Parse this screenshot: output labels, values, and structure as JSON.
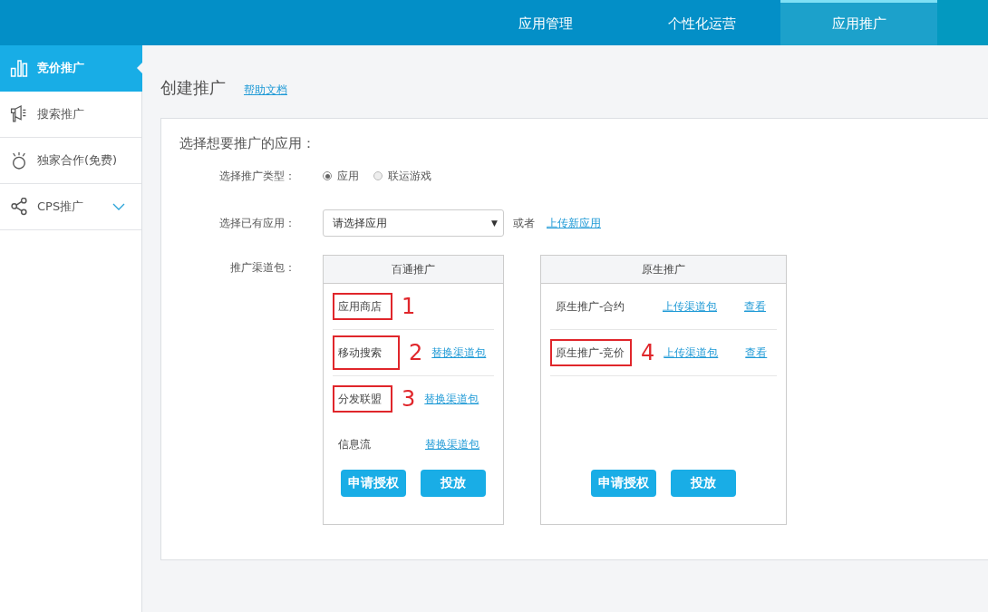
{
  "top_nav": {
    "tabs": [
      {
        "label": "应用管理",
        "selected": false
      },
      {
        "label": "个性化运营",
        "selected": false
      },
      {
        "label": "应用推广",
        "selected": true
      }
    ]
  },
  "sidebar": {
    "items": [
      {
        "label": "竞价推广",
        "selected": true,
        "expandable": false
      },
      {
        "label": "搜索推广",
        "selected": false,
        "expandable": false
      },
      {
        "label": "独家合作(免费)",
        "selected": false,
        "expandable": false
      },
      {
        "label": "CPS推广",
        "selected": false,
        "expandable": true
      }
    ]
  },
  "page": {
    "title": "创建推广",
    "help_link": "帮助文档"
  },
  "form": {
    "heading": "选择想要推广的应用：",
    "type_label": "选择推广类型：",
    "type_options": [
      {
        "label": "应用",
        "selected": true
      },
      {
        "label": "联运游戏",
        "selected": false
      }
    ],
    "app_label": "选择已有应用：",
    "app_select": {
      "value": "请选择应用",
      "caret": "▼"
    },
    "or_text": "或者",
    "upload_link": "上传新应用",
    "channel_label": "推广渠道包：",
    "panels": [
      {
        "title": "百通推广",
        "rows": [
          {
            "label": "应用商店",
            "links": [],
            "annotation": "1",
            "divider": true
          },
          {
            "label": "移动搜索",
            "links": [
              "替换渠道包"
            ],
            "annotation": "2",
            "divider": true
          },
          {
            "label": "分发联盟",
            "links": [
              "替换渠道包"
            ],
            "annotation": "3",
            "divider": false
          },
          {
            "label": "信息流",
            "links": [
              "替换渠道包"
            ],
            "divider": false
          }
        ],
        "buttons": [
          "申请授权",
          "投放"
        ]
      },
      {
        "title": "原生推广",
        "rows": [
          {
            "label": "原生推广-合约",
            "links": [
              "上传渠道包",
              "查看"
            ],
            "divider": true
          },
          {
            "label": "原生推广-竞价",
            "links": [
              "上传渠道包",
              "查看"
            ],
            "annotation": "4",
            "divider": true
          }
        ],
        "buttons": [
          "申请授权",
          "投放"
        ]
      }
    ]
  }
}
